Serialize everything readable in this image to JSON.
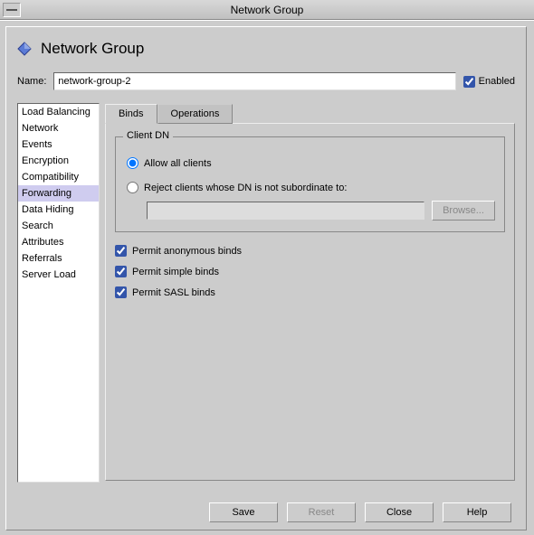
{
  "window": {
    "title": "Network Group"
  },
  "header": {
    "title": "Network Group"
  },
  "form": {
    "name_label": "Name:",
    "name_value": "network-group-2",
    "enabled_label": "Enabled",
    "enabled_checked": true
  },
  "sidebar": {
    "items": [
      {
        "label": "Load Balancing",
        "selected": false
      },
      {
        "label": "Network",
        "selected": false
      },
      {
        "label": "Events",
        "selected": false
      },
      {
        "label": "Encryption",
        "selected": false
      },
      {
        "label": "Compatibility",
        "selected": false
      },
      {
        "label": "Forwarding",
        "selected": true
      },
      {
        "label": "Data Hiding",
        "selected": false
      },
      {
        "label": "Search",
        "selected": false
      },
      {
        "label": "Attributes",
        "selected": false
      },
      {
        "label": "Referrals",
        "selected": false
      },
      {
        "label": "Server Load",
        "selected": false
      }
    ]
  },
  "tabs": {
    "items": [
      {
        "label": "Binds",
        "active": true
      },
      {
        "label": "Operations",
        "active": false
      }
    ]
  },
  "client_dn": {
    "legend": "Client DN",
    "allow_all_label": "Allow all clients",
    "reject_label": "Reject clients whose DN is not subordinate to:",
    "dn_value": "",
    "browse_label": "Browse...",
    "selected": "allow"
  },
  "permits": {
    "anonymous": {
      "label": "Permit anonymous binds",
      "checked": true
    },
    "simple": {
      "label": "Permit simple binds",
      "checked": true
    },
    "sasl": {
      "label": "Permit SASL binds",
      "checked": true
    }
  },
  "buttons": {
    "save": "Save",
    "reset": "Reset",
    "close": "Close",
    "help": "Help"
  }
}
